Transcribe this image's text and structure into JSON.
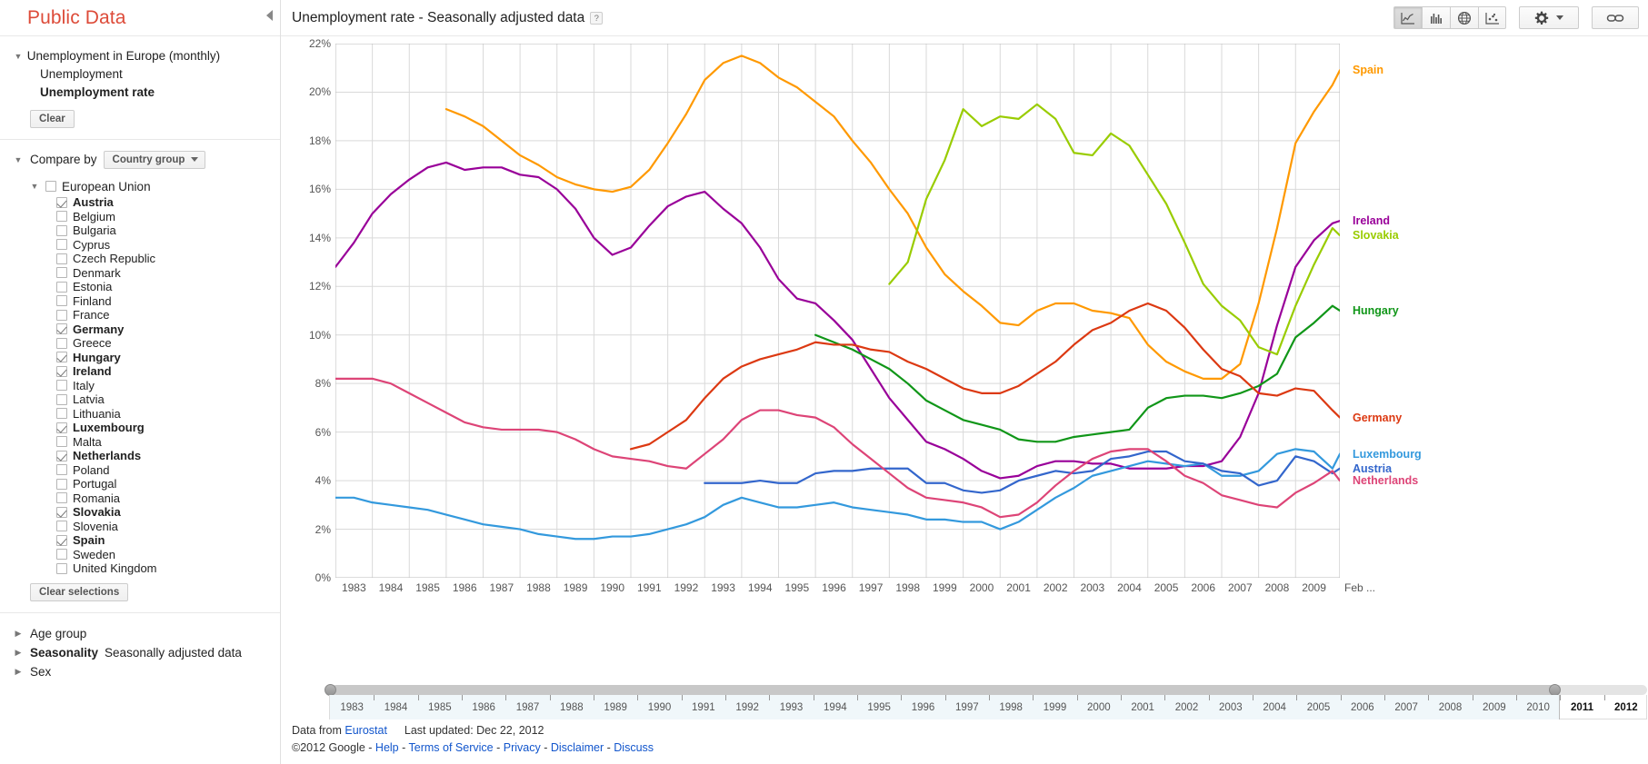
{
  "app": {
    "brand": "Public Data"
  },
  "sidebar": {
    "dataset": {
      "title": "Unemployment in Europe (monthly)",
      "metrics": [
        {
          "label": "Unemployment",
          "selected": false
        },
        {
          "label": "Unemployment rate",
          "selected": true
        }
      ],
      "clear_label": "Clear"
    },
    "compare": {
      "label": "Compare by",
      "dropdown_value": "Country group",
      "group": {
        "label": "European Union",
        "checked": false
      },
      "countries": [
        {
          "label": "Austria",
          "checked": true
        },
        {
          "label": "Belgium",
          "checked": false
        },
        {
          "label": "Bulgaria",
          "checked": false
        },
        {
          "label": "Cyprus",
          "checked": false
        },
        {
          "label": "Czech Republic",
          "checked": false
        },
        {
          "label": "Denmark",
          "checked": false
        },
        {
          "label": "Estonia",
          "checked": false
        },
        {
          "label": "Finland",
          "checked": false
        },
        {
          "label": "France",
          "checked": false
        },
        {
          "label": "Germany",
          "checked": true
        },
        {
          "label": "Greece",
          "checked": false
        },
        {
          "label": "Hungary",
          "checked": true
        },
        {
          "label": "Ireland",
          "checked": true
        },
        {
          "label": "Italy",
          "checked": false
        },
        {
          "label": "Latvia",
          "checked": false
        },
        {
          "label": "Lithuania",
          "checked": false
        },
        {
          "label": "Luxembourg",
          "checked": true
        },
        {
          "label": "Malta",
          "checked": false
        },
        {
          "label": "Netherlands",
          "checked": true
        },
        {
          "label": "Poland",
          "checked": false
        },
        {
          "label": "Portugal",
          "checked": false
        },
        {
          "label": "Romania",
          "checked": false
        },
        {
          "label": "Slovakia",
          "checked": true
        },
        {
          "label": "Slovenia",
          "checked": false
        },
        {
          "label": "Spain",
          "checked": true
        },
        {
          "label": "Sweden",
          "checked": false
        },
        {
          "label": "United Kingdom",
          "checked": false
        }
      ],
      "clear_selections_label": "Clear selections"
    },
    "facets": [
      {
        "label": "Age group",
        "value": "",
        "bold": false
      },
      {
        "label": "Seasonality",
        "value": "Seasonally adjusted data",
        "bold": true
      },
      {
        "label": "Sex",
        "value": "",
        "bold": false
      }
    ]
  },
  "header": {
    "title": "Unemployment rate - Seasonally adjusted data",
    "help_badge": "?",
    "collapse_icon": "chevron-left-icon",
    "view_buttons": [
      {
        "name": "line-chart-view",
        "icon": "line-chart-icon",
        "active": true
      },
      {
        "name": "bar-chart-view",
        "icon": "bar-chart-icon",
        "active": false
      },
      {
        "name": "map-view",
        "icon": "globe-icon",
        "active": false
      },
      {
        "name": "scatter-view",
        "icon": "scatter-plot-icon",
        "active": false
      }
    ],
    "settings_button": {
      "name": "settings-button",
      "icon": "gear-icon",
      "caret": "chevron-down-icon"
    },
    "link_button": {
      "name": "link-button",
      "icon": "link-icon"
    }
  },
  "timeline": {
    "years": [
      1983,
      1984,
      1985,
      1986,
      1987,
      1988,
      1989,
      1990,
      1991,
      1992,
      1993,
      1994,
      1995,
      1996,
      1997,
      1998,
      1999,
      2000,
      2001,
      2002,
      2003,
      2004,
      2005,
      2006,
      2007,
      2008,
      2009,
      2010,
      2011,
      2012
    ],
    "selected_start": 1983,
    "selected_end_label": "2010",
    "outside_labels": [
      2011,
      2012
    ]
  },
  "footer": {
    "data_from_label": "Data from",
    "data_source": "Eurostat",
    "last_updated": "Last updated: Dec 22, 2012",
    "copyright": "©2012 Google",
    "links": [
      "Help",
      "Terms of Service",
      "Privacy",
      "Disclaimer",
      "Discuss"
    ]
  },
  "chart_data": {
    "type": "line",
    "title": "Unemployment rate - Seasonally adjusted data",
    "xlabel": "",
    "ylabel": "",
    "grid": true,
    "legend": "right-inline",
    "ylim": [
      0,
      22
    ],
    "yticks": [
      "0%",
      "2%",
      "4%",
      "6%",
      "8%",
      "10%",
      "12%",
      "14%",
      "16%",
      "18%",
      "20%",
      "22%"
    ],
    "ytick_values": [
      0,
      2,
      4,
      6,
      8,
      10,
      12,
      14,
      16,
      18,
      20,
      22
    ],
    "xlim": [
      1983.0,
      2010.2
    ],
    "xticks": [
      1983,
      1984,
      1985,
      1986,
      1987,
      1988,
      1989,
      1990,
      1991,
      1992,
      1993,
      1994,
      1995,
      1996,
      1997,
      1998,
      1999,
      2000,
      2001,
      2002,
      2003,
      2004,
      2005,
      2006,
      2007,
      2008,
      2009
    ],
    "xtick_labels": [
      "1983",
      "1984",
      "1985",
      "1986",
      "1987",
      "1988",
      "1989",
      "1990",
      "1991",
      "1992",
      "1993",
      "1994",
      "1995",
      "1996",
      "1997",
      "1998",
      "1999",
      "2000",
      "2001",
      "2002",
      "2003",
      "2004",
      "2005",
      "2006",
      "2007",
      "2008",
      "2009"
    ],
    "x_end_label": "Feb ...",
    "series": [
      {
        "name": "Spain",
        "color": "#FF9900",
        "label_y_pct": 20.9,
        "x": [
          1986.0,
          1986.5,
          1987.0,
          1987.5,
          1988.0,
          1988.5,
          1989.0,
          1989.5,
          1990.0,
          1990.5,
          1991.0,
          1991.5,
          1992.0,
          1992.5,
          1993.0,
          1993.5,
          1994.0,
          1994.5,
          1995.0,
          1995.5,
          1996.0,
          1996.5,
          1997.0,
          1997.5,
          1998.0,
          1998.5,
          1999.0,
          1999.5,
          2000.0,
          2000.5,
          2001.0,
          2001.5,
          2002.0,
          2002.5,
          2003.0,
          2003.5,
          2004.0,
          2004.5,
          2005.0,
          2005.5,
          2006.0,
          2006.5,
          2007.0,
          2007.5,
          2008.0,
          2008.5,
          2009.0,
          2009.5,
          2010.0,
          2010.2
        ],
        "y": [
          19.3,
          19.0,
          18.6,
          18.0,
          17.4,
          17.0,
          16.5,
          16.2,
          16.0,
          15.9,
          16.1,
          16.8,
          17.9,
          19.1,
          20.5,
          21.2,
          21.5,
          21.2,
          20.6,
          20.2,
          19.6,
          19.0,
          18.0,
          17.1,
          16.0,
          15.0,
          13.6,
          12.5,
          11.8,
          11.2,
          10.5,
          10.4,
          11.0,
          11.3,
          11.3,
          11.0,
          10.9,
          10.7,
          9.6,
          8.9,
          8.5,
          8.2,
          8.2,
          8.8,
          11.3,
          14.4,
          17.9,
          19.2,
          20.3,
          20.9
        ]
      },
      {
        "name": "Ireland",
        "color": "#990099",
        "label_y_pct": 14.7,
        "x": [
          1983.0,
          1983.5,
          1984.0,
          1984.5,
          1985.0,
          1985.5,
          1986.0,
          1986.5,
          1987.0,
          1987.5,
          1988.0,
          1988.5,
          1989.0,
          1989.5,
          1990.0,
          1990.5,
          1991.0,
          1991.5,
          1992.0,
          1992.5,
          1993.0,
          1993.5,
          1994.0,
          1994.5,
          1995.0,
          1995.5,
          1996.0,
          1996.5,
          1997.0,
          1997.5,
          1998.0,
          1998.5,
          1999.0,
          1999.5,
          2000.0,
          2000.5,
          2001.0,
          2001.5,
          2002.0,
          2002.5,
          2003.0,
          2003.5,
          2004.0,
          2004.5,
          2005.0,
          2005.5,
          2006.0,
          2006.5,
          2007.0,
          2007.5,
          2008.0,
          2008.5,
          2009.0,
          2009.5,
          2010.0,
          2010.2
        ],
        "y": [
          12.8,
          13.8,
          15.0,
          15.8,
          16.4,
          16.9,
          17.1,
          16.8,
          16.9,
          16.9,
          16.6,
          16.5,
          16.0,
          15.2,
          14.0,
          13.3,
          13.6,
          14.5,
          15.3,
          15.7,
          15.9,
          15.2,
          14.6,
          13.6,
          12.3,
          11.5,
          11.3,
          10.6,
          9.8,
          8.6,
          7.4,
          6.5,
          5.6,
          5.3,
          4.9,
          4.4,
          4.1,
          4.2,
          4.6,
          4.8,
          4.8,
          4.7,
          4.7,
          4.5,
          4.5,
          4.5,
          4.6,
          4.6,
          4.8,
          5.8,
          7.6,
          10.4,
          12.8,
          13.9,
          14.6,
          14.7
        ]
      },
      {
        "name": "Slovakia",
        "color": "#99CC00",
        "label_y_pct": 14.1,
        "x": [
          1998.0,
          1998.5,
          1999.0,
          1999.5,
          2000.0,
          2000.5,
          2001.0,
          2001.5,
          2002.0,
          2002.5,
          2003.0,
          2003.5,
          2004.0,
          2004.5,
          2005.0,
          2005.5,
          2006.0,
          2006.5,
          2007.0,
          2007.5,
          2008.0,
          2008.5,
          2009.0,
          2009.5,
          2010.0,
          2010.2
        ],
        "y": [
          12.1,
          13.0,
          15.6,
          17.2,
          19.3,
          18.6,
          19.0,
          18.9,
          19.5,
          18.9,
          17.5,
          17.4,
          18.3,
          17.8,
          16.6,
          15.4,
          13.8,
          12.1,
          11.2,
          10.6,
          9.5,
          9.2,
          11.2,
          12.9,
          14.4,
          14.1
        ]
      },
      {
        "name": "Hungary",
        "color": "#109618",
        "label_y_pct": 11.0,
        "x": [
          1996.0,
          1996.5,
          1997.0,
          1997.5,
          1998.0,
          1998.5,
          1999.0,
          1999.5,
          2000.0,
          2000.5,
          2001.0,
          2001.5,
          2002.0,
          2002.5,
          2003.0,
          2003.5,
          2004.0,
          2004.5,
          2005.0,
          2005.5,
          2006.0,
          2006.5,
          2007.0,
          2007.5,
          2008.0,
          2008.5,
          2009.0,
          2009.5,
          2010.0,
          2010.2
        ],
        "y": [
          10.0,
          9.7,
          9.4,
          9.0,
          8.6,
          8.0,
          7.3,
          6.9,
          6.5,
          6.3,
          6.1,
          5.7,
          5.6,
          5.6,
          5.8,
          5.9,
          6.0,
          6.1,
          7.0,
          7.4,
          7.5,
          7.5,
          7.4,
          7.6,
          7.9,
          8.4,
          9.9,
          10.5,
          11.2,
          11.0
        ]
      },
      {
        "name": "Germany",
        "color": "#DC3912",
        "label_y_pct": 6.6,
        "x": [
          1991.0,
          1991.5,
          1992.0,
          1992.5,
          1993.0,
          1993.5,
          1994.0,
          1994.5,
          1995.0,
          1995.5,
          1996.0,
          1996.5,
          1997.0,
          1997.5,
          1998.0,
          1998.5,
          1999.0,
          1999.5,
          2000.0,
          2000.5,
          2001.0,
          2001.5,
          2002.0,
          2002.5,
          2003.0,
          2003.5,
          2004.0,
          2004.5,
          2005.0,
          2005.5,
          2006.0,
          2006.5,
          2007.0,
          2007.5,
          2008.0,
          2008.5,
          2009.0,
          2009.5,
          2010.0,
          2010.2
        ],
        "y": [
          5.3,
          5.5,
          6.0,
          6.5,
          7.4,
          8.2,
          8.7,
          9.0,
          9.2,
          9.4,
          9.7,
          9.6,
          9.6,
          9.4,
          9.3,
          8.9,
          8.6,
          8.2,
          7.8,
          7.6,
          7.6,
          7.9,
          8.4,
          8.9,
          9.6,
          10.2,
          10.5,
          11.0,
          11.3,
          11.0,
          10.3,
          9.4,
          8.6,
          8.3,
          7.6,
          7.5,
          7.8,
          7.7,
          6.9,
          6.6
        ]
      },
      {
        "name": "Luxembourg",
        "color": "#3399DD",
        "label_y_pct": 5.1,
        "x": [
          1983.0,
          1983.5,
          1984.0,
          1984.5,
          1985.0,
          1985.5,
          1986.0,
          1986.5,
          1987.0,
          1987.5,
          1988.0,
          1988.5,
          1989.0,
          1989.5,
          1990.0,
          1990.5,
          1991.0,
          1991.5,
          1992.0,
          1992.5,
          1993.0,
          1993.5,
          1994.0,
          1994.5,
          1995.0,
          1995.5,
          1996.0,
          1996.5,
          1997.0,
          1997.5,
          1998.0,
          1998.5,
          1999.0,
          1999.5,
          2000.0,
          2000.5,
          2001.0,
          2001.5,
          2002.0,
          2002.5,
          2003.0,
          2003.5,
          2004.0,
          2004.5,
          2005.0,
          2005.5,
          2006.0,
          2006.5,
          2007.0,
          2007.5,
          2008.0,
          2008.5,
          2009.0,
          2009.5,
          2010.0,
          2010.2
        ],
        "y": [
          3.3,
          3.3,
          3.1,
          3.0,
          2.9,
          2.8,
          2.6,
          2.4,
          2.2,
          2.1,
          2.0,
          1.8,
          1.7,
          1.6,
          1.6,
          1.7,
          1.7,
          1.8,
          2.0,
          2.2,
          2.5,
          3.0,
          3.3,
          3.1,
          2.9,
          2.9,
          3.0,
          3.1,
          2.9,
          2.8,
          2.7,
          2.6,
          2.4,
          2.4,
          2.3,
          2.3,
          2.0,
          2.3,
          2.8,
          3.3,
          3.7,
          4.2,
          4.4,
          4.6,
          4.8,
          4.7,
          4.6,
          4.7,
          4.2,
          4.2,
          4.4,
          5.1,
          5.3,
          5.2,
          4.5,
          5.1
        ]
      },
      {
        "name": "Austria",
        "color": "#3366CC",
        "label_y_pct": 4.5,
        "x": [
          1993.0,
          1993.5,
          1994.0,
          1994.5,
          1995.0,
          1995.5,
          1996.0,
          1996.5,
          1997.0,
          1997.5,
          1998.0,
          1998.5,
          1999.0,
          1999.5,
          2000.0,
          2000.5,
          2001.0,
          2001.5,
          2002.0,
          2002.5,
          2003.0,
          2003.5,
          2004.0,
          2004.5,
          2005.0,
          2005.5,
          2006.0,
          2006.5,
          2007.0,
          2007.5,
          2008.0,
          2008.5,
          2009.0,
          2009.5,
          2010.0,
          2010.2
        ],
        "y": [
          3.9,
          3.9,
          3.9,
          4.0,
          3.9,
          3.9,
          4.3,
          4.4,
          4.4,
          4.5,
          4.5,
          4.5,
          3.9,
          3.9,
          3.6,
          3.5,
          3.6,
          4.0,
          4.2,
          4.4,
          4.3,
          4.4,
          4.9,
          5.0,
          5.2,
          5.2,
          4.8,
          4.7,
          4.4,
          4.3,
          3.8,
          4.0,
          5.0,
          4.8,
          4.3,
          4.5
        ]
      },
      {
        "name": "Netherlands",
        "color": "#DD4477",
        "label_y_pct": 4.0,
        "x": [
          1983.0,
          1983.5,
          1984.0,
          1984.5,
          1985.0,
          1985.5,
          1986.0,
          1986.5,
          1987.0,
          1987.5,
          1988.0,
          1988.5,
          1989.0,
          1989.5,
          1990.0,
          1990.5,
          1991.0,
          1991.5,
          1992.0,
          1992.5,
          1993.0,
          1993.5,
          1994.0,
          1994.5,
          1995.0,
          1995.5,
          1996.0,
          1996.5,
          1997.0,
          1997.5,
          1998.0,
          1998.5,
          1999.0,
          1999.5,
          2000.0,
          2000.5,
          2001.0,
          2001.5,
          2002.0,
          2002.5,
          2003.0,
          2003.5,
          2004.0,
          2004.5,
          2005.0,
          2005.5,
          2006.0,
          2006.5,
          2007.0,
          2007.5,
          2008.0,
          2008.5,
          2009.0,
          2009.5,
          2010.0,
          2010.2
        ],
        "y": [
          8.2,
          8.2,
          8.2,
          8.0,
          7.6,
          7.2,
          6.8,
          6.4,
          6.2,
          6.1,
          6.1,
          6.1,
          6.0,
          5.7,
          5.3,
          5.0,
          4.9,
          4.8,
          4.6,
          4.5,
          5.1,
          5.7,
          6.5,
          6.9,
          6.9,
          6.7,
          6.6,
          6.2,
          5.5,
          4.9,
          4.3,
          3.7,
          3.3,
          3.2,
          3.1,
          2.9,
          2.5,
          2.6,
          3.1,
          3.8,
          4.4,
          4.9,
          5.2,
          5.3,
          5.3,
          4.8,
          4.2,
          3.9,
          3.4,
          3.2,
          3.0,
          2.9,
          3.5,
          3.9,
          4.4,
          4.0
        ]
      }
    ]
  }
}
